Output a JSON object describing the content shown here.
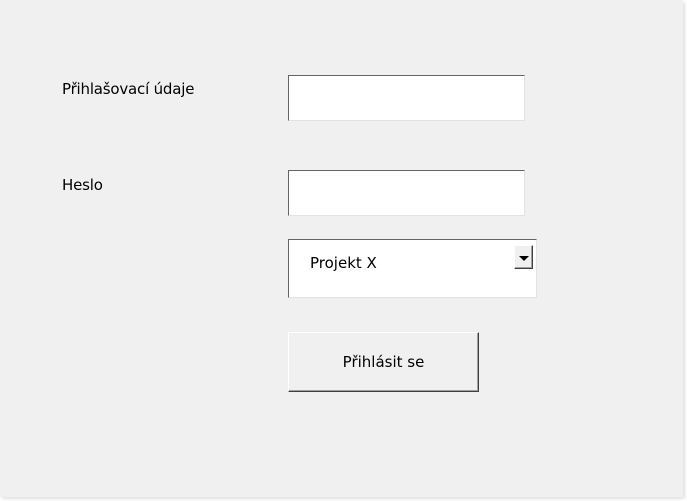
{
  "form": {
    "login_label": "Přihlašovací údaje",
    "login_value": "",
    "password_label": "Heslo",
    "password_value": "",
    "project_select": {
      "selected": "Projekt X"
    },
    "submit_label": "Přihlásit se"
  },
  "icons": {
    "dropdown": "chevron-down-icon"
  },
  "colors": {
    "window_background": "#f0f0f0",
    "field_background": "#ffffff"
  }
}
